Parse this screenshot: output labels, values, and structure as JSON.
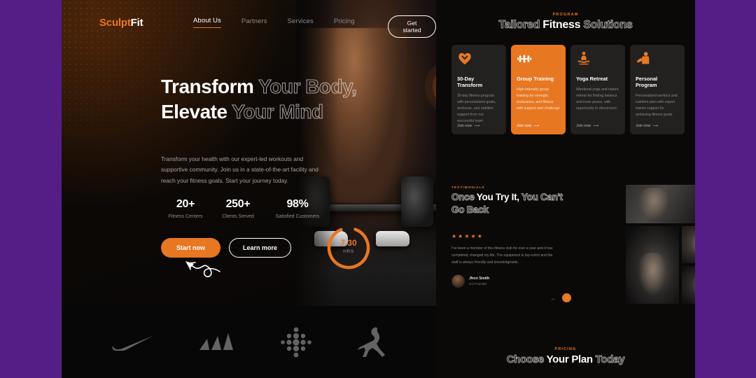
{
  "theme": {
    "accent": "#E87722",
    "purple_frame": "#551E87",
    "dark_bg": "#0a0908",
    "card_bg": "#232120"
  },
  "nav": {
    "logo_first": "Sculpt",
    "logo_second": "Fit",
    "links": [
      {
        "label": "About Us",
        "active": true
      },
      {
        "label": "Partners",
        "active": false
      },
      {
        "label": "Services",
        "active": false
      },
      {
        "label": "Pricing",
        "active": false
      }
    ],
    "cta_label": "Get started"
  },
  "hero": {
    "headline": {
      "line1_solid": "Transform",
      "line1_outline": "Your",
      "line2_outline_a": "Body,",
      "line2_solid": "Elevate",
      "line2_outline_b": "Your",
      "line3_outline": "Mind"
    },
    "subtext": "Transform your health with our expert-led workouts and supportive community. Join us in a state-of-the-art facility and reach your fitness goals. Start your journey today.",
    "stats": [
      {
        "value": "20+",
        "label": "Fitness Centers"
      },
      {
        "value": "250+",
        "label": "Clients Served"
      },
      {
        "value": "98%",
        "label": "Satisfied Customers"
      }
    ],
    "primary_button": "Start now",
    "secondary_button": "Learn more",
    "timer": {
      "value": "7.30",
      "unit": "HRS",
      "progress_pct": 88
    }
  },
  "brands": [
    {
      "name": "nike-logo"
    },
    {
      "name": "adidas-logo"
    },
    {
      "name": "fitbit-logo"
    },
    {
      "name": "jordan-logo"
    }
  ],
  "program": {
    "eyebrow": "PROGRAM",
    "title_outline_a": "Tailored",
    "title_solid": "Fitness",
    "title_outline_b": "Solutions",
    "cards": [
      {
        "icon": "heart-chevron-icon",
        "title": "30-Day Transform",
        "body": "30-day fitness program with personalized goals, workouts, and nutrition support from our successful team",
        "link": "Join now",
        "accent": false
      },
      {
        "icon": "dumbbell-icon",
        "title": "Group Training",
        "body": "High-intensity group training for strength, endurance, and fitness with support and challenge",
        "link": "Join now",
        "accent": true
      },
      {
        "icon": "yoga-icon",
        "title": "Yoga Retreat",
        "body": "Weekend yoga and nature retreat for finding balance and inner peace, with opportunity to disconnect.",
        "link": "Join now",
        "accent": false
      },
      {
        "icon": "flexing-arm-icon",
        "title": "Personal Program",
        "body": "Personalized workout and nutrition plan with expert trainer support for achieving fitness goals.",
        "link": "Join now",
        "accent": false
      }
    ]
  },
  "testimonials": {
    "eyebrow": "TESTIMONIALS",
    "title_outline_a": "Once",
    "title_solid": "You Try It,",
    "title_outline_b": "You Can't Go Back",
    "rating": 5,
    "star_glyph": "★",
    "quote": "I've been a member of this fitness club for over a year and it has completely changed my life. The equipment is top-notch and the staff is always friendly and knowledgeable.",
    "author_name": "Jhon Smith",
    "author_role": "CO-Founder",
    "prev_glyph": "←",
    "next_glyph": "→"
  },
  "pricing": {
    "eyebrow": "PRICING",
    "title_outline_a": "Choose",
    "title_solid": "Your Plan",
    "title_outline_b": "Today"
  }
}
